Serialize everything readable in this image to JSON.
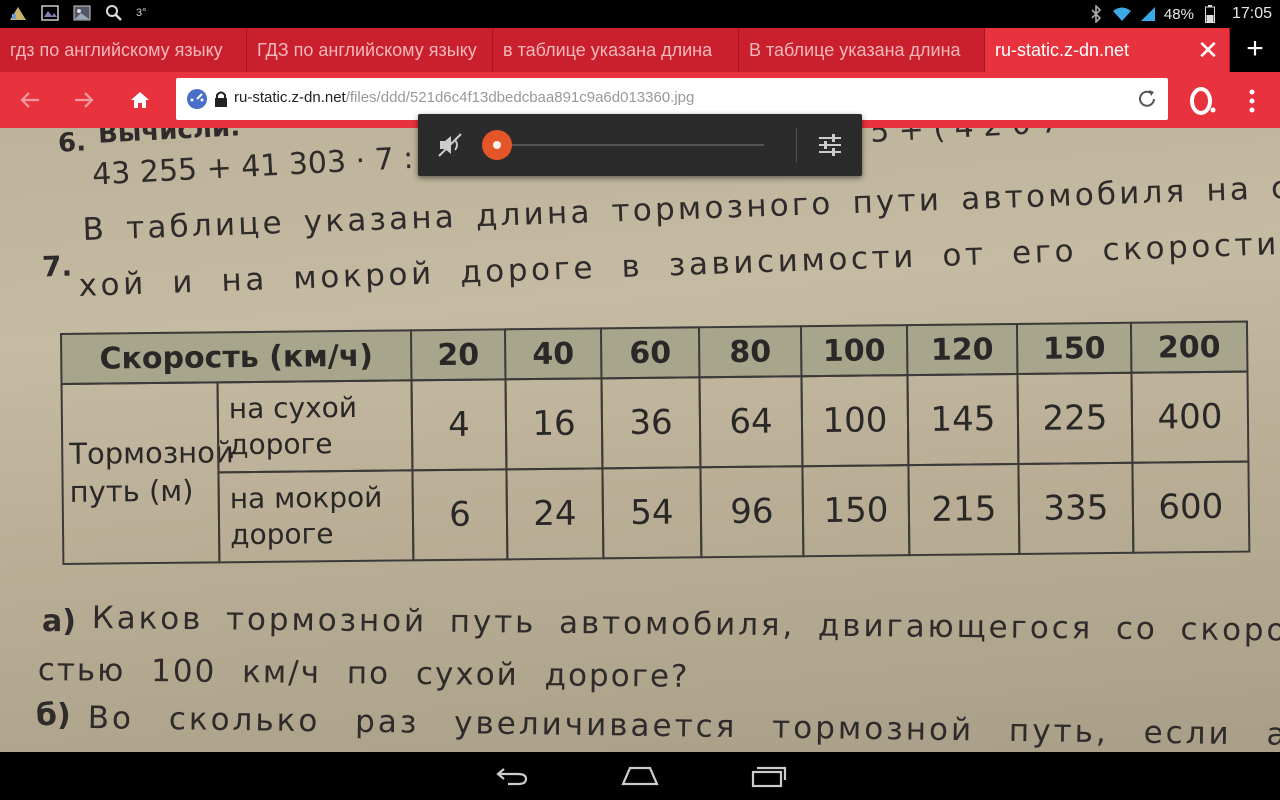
{
  "status_bar": {
    "battery": "48%",
    "time": "17:05",
    "left_icons": [
      "notification-icon",
      "image-icon",
      "gallery-icon",
      "search-icon",
      "temperature-icon"
    ],
    "right_icons": [
      "bluetooth-icon",
      "wifi-icon",
      "signal-icon",
      "battery-icon"
    ],
    "temp_label": "3°"
  },
  "tabs": [
    {
      "label": "гдз по английскому языку",
      "active": false
    },
    {
      "label": "ГДЗ по английскому языку",
      "active": false
    },
    {
      "label": "в таблице указана длина",
      "active": false
    },
    {
      "label": "В таблице указана длина",
      "active": false
    },
    {
      "label": "ru-static.z-dn.net",
      "active": true
    }
  ],
  "toolbar": {
    "url_host": "ru-static.z-dn.net",
    "url_path": "/files/ddd/521d6c4f13dbedcbaa891c9a6d013360.jpg"
  },
  "photo": {
    "line1_num": "6.",
    "line1_text": "Вычисли:",
    "line2": "43 255 + 41 303 · 7 : 10",
    "line2_right": "5 + ( 4 2 0 7",
    "task_num": "7.",
    "task_line1": "В таблице указана длина тормозного пути автомобиля на су-",
    "task_line2": "хой и на мокрой дороге в зависимости от его скорости.",
    "table": {
      "speed_label": "Скорость (км/ч)",
      "speeds": [
        "20",
        "40",
        "60",
        "80",
        "100",
        "120",
        "150",
        "200"
      ],
      "row_group_label": [
        "Тормозной",
        "путь (м)"
      ],
      "rows": [
        {
          "label": [
            "на сухой",
            "дороге"
          ],
          "values": [
            "4",
            "16",
            "36",
            "64",
            "100",
            "145",
            "225",
            "400"
          ]
        },
        {
          "label": [
            "на мокрой",
            "дороге"
          ],
          "values": [
            "6",
            "24",
            "54",
            "96",
            "150",
            "215",
            "335",
            "600"
          ]
        }
      ]
    },
    "qa_num": "а)",
    "qa_line1": "Каков тормозной путь автомобиля, двигающегося со скоро-",
    "qa_line2": "стью 100 км/ч по сухой дороге?",
    "qb_num": "б)",
    "qb_line1": "Во сколько раз увеличивается тормозной путь, если авто-"
  },
  "media_control": {
    "progress": 0.0
  },
  "colors": {
    "tab_strip": "#ca1f2c",
    "toolbar": "#e8323d",
    "table_header": "#a8a58d",
    "media_knob": "#e4562a"
  }
}
